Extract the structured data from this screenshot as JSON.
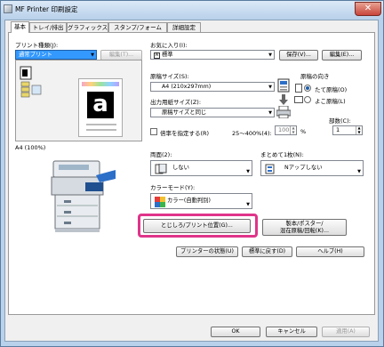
{
  "window": {
    "title": "MF Printer 印刷設定",
    "close_label": "✕"
  },
  "tabs": [
    {
      "label": "基本",
      "active": true
    },
    {
      "label": "トレイ/排出",
      "active": false
    },
    {
      "label": "グラフィックス",
      "active": false
    },
    {
      "label": "スタンプ/フォーム",
      "active": false
    },
    {
      "label": "詳細設定",
      "active": false
    }
  ],
  "left": {
    "print_type_label": "プリント種類(J):",
    "print_type_value": "通常プリント",
    "edit_button": "編集(T)...",
    "paper_caption": "A4 (100%)"
  },
  "favorites": {
    "label": "お気に入り(I):",
    "value": "標準",
    "value_icon": "A",
    "save_button": "保存(V)...",
    "edit_button": "編集(E)..."
  },
  "paper": {
    "size_label": "原稿サイズ(S):",
    "size_value": "A4 (210x297mm)",
    "output_label": "出力用紙サイズ(Z):",
    "output_value": "原稿サイズと同じ",
    "scale_label": "倍率を指定する(R)",
    "scale_range": "25〜400%(4):",
    "scale_value": "100",
    "scale_unit": "%"
  },
  "orientation": {
    "label": "原稿の向き",
    "options": [
      {
        "label": "たて原稿(O)",
        "selected": true
      },
      {
        "label": "よこ原稿(L)",
        "selected": false
      }
    ]
  },
  "copies": {
    "label": "部数(C):",
    "value": "1"
  },
  "duplex": {
    "label": "両面(2):",
    "value": "しない"
  },
  "nup": {
    "label": "まとめて1枚(N):",
    "value": "Nアップしない"
  },
  "color": {
    "label": "カラーモード(Y):",
    "value": "カラー(自動判別)"
  },
  "buttons": {
    "binding": "とじしろ/プリント位置(G)...",
    "booklet_line1": "製本/ポスター/",
    "booklet_line2": "混在原稿/回転(K)...",
    "printer_status": "プリンターの状態(U)",
    "restore_defaults": "標準に戻す(D)",
    "help": "ヘルプ(H)"
  },
  "footer": {
    "ok": "OK",
    "cancel": "キャンセル",
    "apply": "適用(A)"
  },
  "colors": {
    "highlight": "#e0348a",
    "selection": "#3399ff",
    "title_bg": "#b9d1ea"
  },
  "icons": [
    "app-icon",
    "paper-preview-icon",
    "printer-icon",
    "duplex-icon",
    "nup-icon",
    "color-mode-icon",
    "portrait-page-icon",
    "landscape-page-icon",
    "printer-output-icon"
  ]
}
